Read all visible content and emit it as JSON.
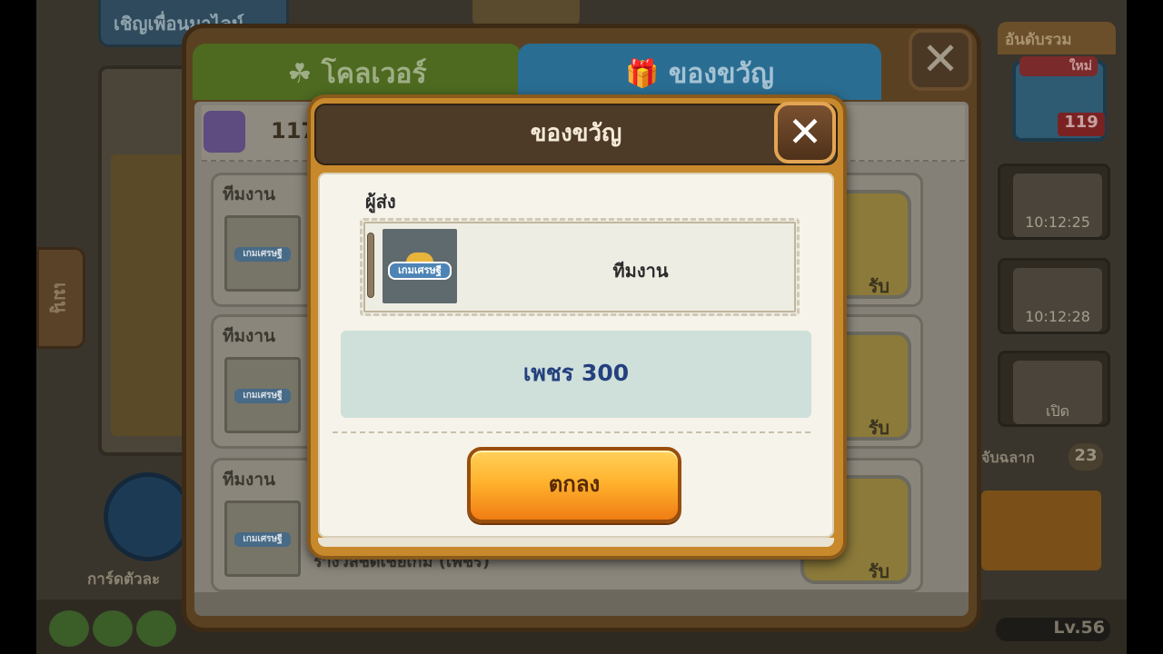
{
  "background": {
    "invite_label": "เชิญเพื่อนมาไลน์",
    "menu_tab_label": "เมนู",
    "rank_tab_label": "อันดับรวม",
    "mail_new_badge": "ใหม่",
    "mail_count": "119",
    "slot_timers": [
      "10:12:25",
      "10:12:28",
      "เปิด"
    ],
    "key_label": "จับฉลาก",
    "key_count": "23",
    "card_label": "การ์ดตัวละ",
    "level": "Lv.56",
    "profile_count": "11"
  },
  "main_dialog": {
    "tab_clover": "☘ โคลเวอร์",
    "tab_gift": "🎁 ของขวัญ",
    "close_label": "✕",
    "gift_count": "117",
    "rows": [
      {
        "sender": "ทีมงาน",
        "logo": "เกมเศรษฐี",
        "claim": "รับ",
        "subtitle": ""
      },
      {
        "sender": "ทีมงาน",
        "logo": "เกมเศรษฐี",
        "claim": "รับ",
        "subtitle": ""
      },
      {
        "sender": "ทีมงาน",
        "logo": "เกมเศรษฐี",
        "claim": "รับ",
        "subtitle": "รางวัลชดเชยเกม (เพชร)"
      }
    ]
  },
  "popup": {
    "title": "ของขวัญ",
    "close_label": "✕",
    "sender_label": "ผู้ส่ง",
    "sender_name": "ทีมงาน",
    "sender_logo": "เกมเศรษฐี",
    "reward": "เพชร 300",
    "ok_label": "ตกลง"
  },
  "colors": {
    "popup_frame": "#c7892b",
    "popup_header": "#4d3a27",
    "reward_bg": "#cfe0da",
    "reward_text": "#24407e",
    "ok_button": "#ffb32e"
  }
}
